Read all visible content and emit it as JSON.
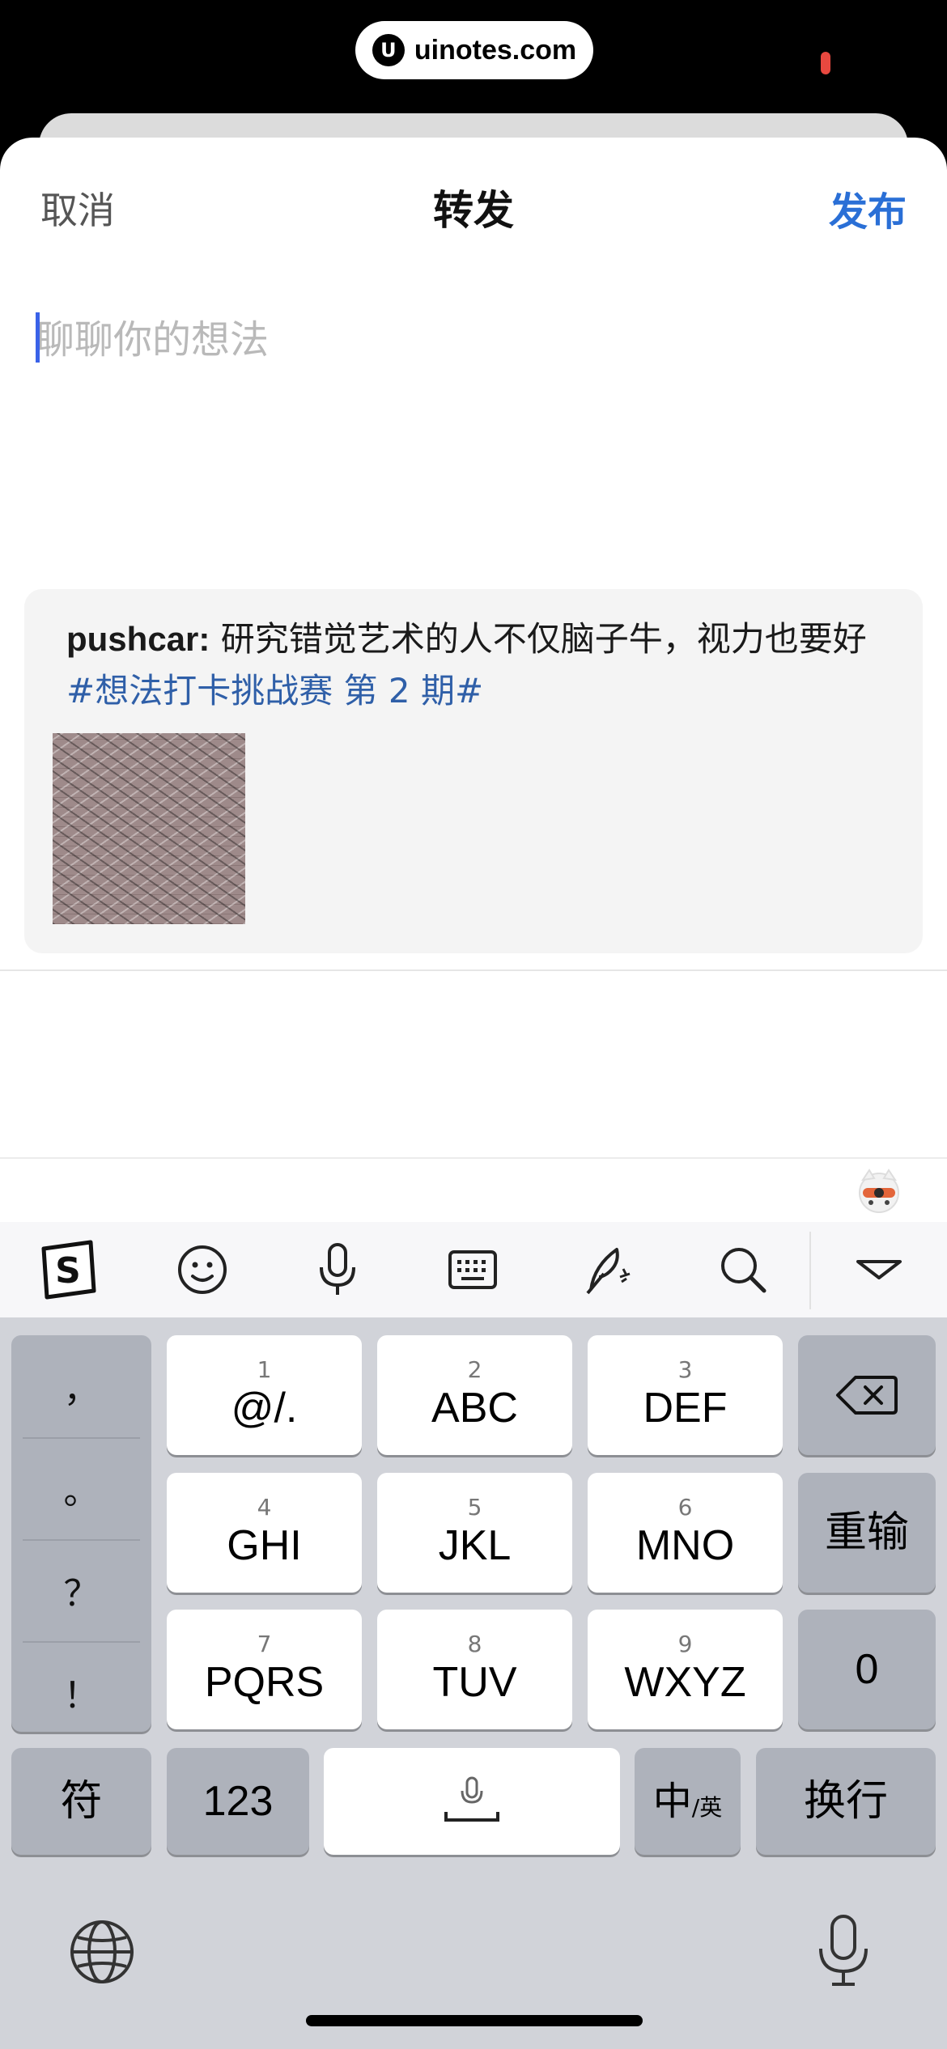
{
  "status": {
    "site_label": "uinotes.com",
    "site_logo": "U"
  },
  "nav": {
    "cancel": "取消",
    "title": "转发",
    "publish": "发布"
  },
  "compose": {
    "placeholder": "聊聊你的想法",
    "value": ""
  },
  "repost": {
    "user": "pushcar:",
    "text": " 研究错觉艺术的人不仅脑子牛，视力也要好 ",
    "tag": "#想法打卡挑战赛 第 2 期#"
  },
  "keyboard": {
    "toolbar": [
      "sogou-logo-icon",
      "emoji-icon",
      "microphone-icon",
      "keyboard-icon",
      "handwriting-icon",
      "search-icon",
      "collapse-icon"
    ],
    "punctuation": [
      "，",
      "。",
      "？",
      "！"
    ],
    "keys": [
      {
        "num": "1",
        "label": "@/."
      },
      {
        "num": "2",
        "label": "ABC"
      },
      {
        "num": "3",
        "label": "DEF"
      },
      {
        "num": "4",
        "label": "GHI"
      },
      {
        "num": "5",
        "label": "JKL"
      },
      {
        "num": "6",
        "label": "MNO"
      },
      {
        "num": "7",
        "label": "PQRS"
      },
      {
        "num": "8",
        "label": "TUV"
      },
      {
        "num": "9",
        "label": "WXYZ"
      }
    ],
    "backspace_icon": "backspace-icon",
    "reenter": "重输",
    "zero": "0",
    "symbols": "符",
    "numbers": "123",
    "lang_main": "中",
    "lang_sub": "/英",
    "newline": "换行",
    "globe_icon": "globe-icon",
    "dictation_icon": "microphone-icon"
  },
  "colors": {
    "accent": "#2a6fd6",
    "tag": "#2f5fa8",
    "caret": "#3a62e8",
    "keyboard_bg": "#d1d3d9"
  }
}
